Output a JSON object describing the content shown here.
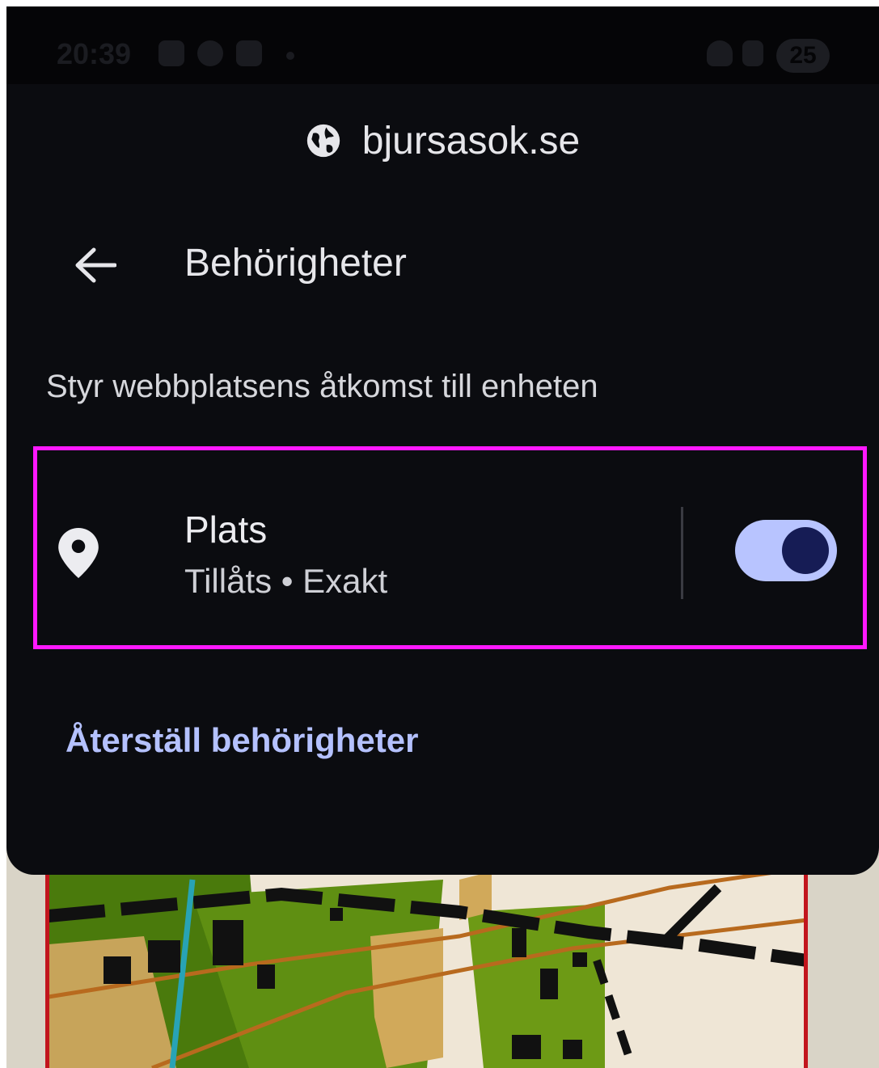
{
  "status_bar": {
    "time": "20:39",
    "battery": "25",
    "icons": [
      "screenshot-icon",
      "media-icon",
      "cast-icon",
      "wifi-icon",
      "signal-icon"
    ]
  },
  "sheet": {
    "site_name": "bjursasok.se",
    "site_icon": "globe-icon",
    "title": "Behörigheter",
    "subtitle": "Styr webbplatsens åtkomst till enheten",
    "permissions": [
      {
        "name": "Plats",
        "status": "Tillåts • Exakt",
        "icon": "location-pin-icon",
        "enabled": true
      }
    ],
    "reset_label": "Återställ behörigheter"
  },
  "colors": {
    "sheet_background": "#0b0c10",
    "highlight_border": "#ff19ff",
    "toggle_track": "#b8c4ff",
    "toggle_knob": "#161c55",
    "link": "#b4c1ff"
  }
}
